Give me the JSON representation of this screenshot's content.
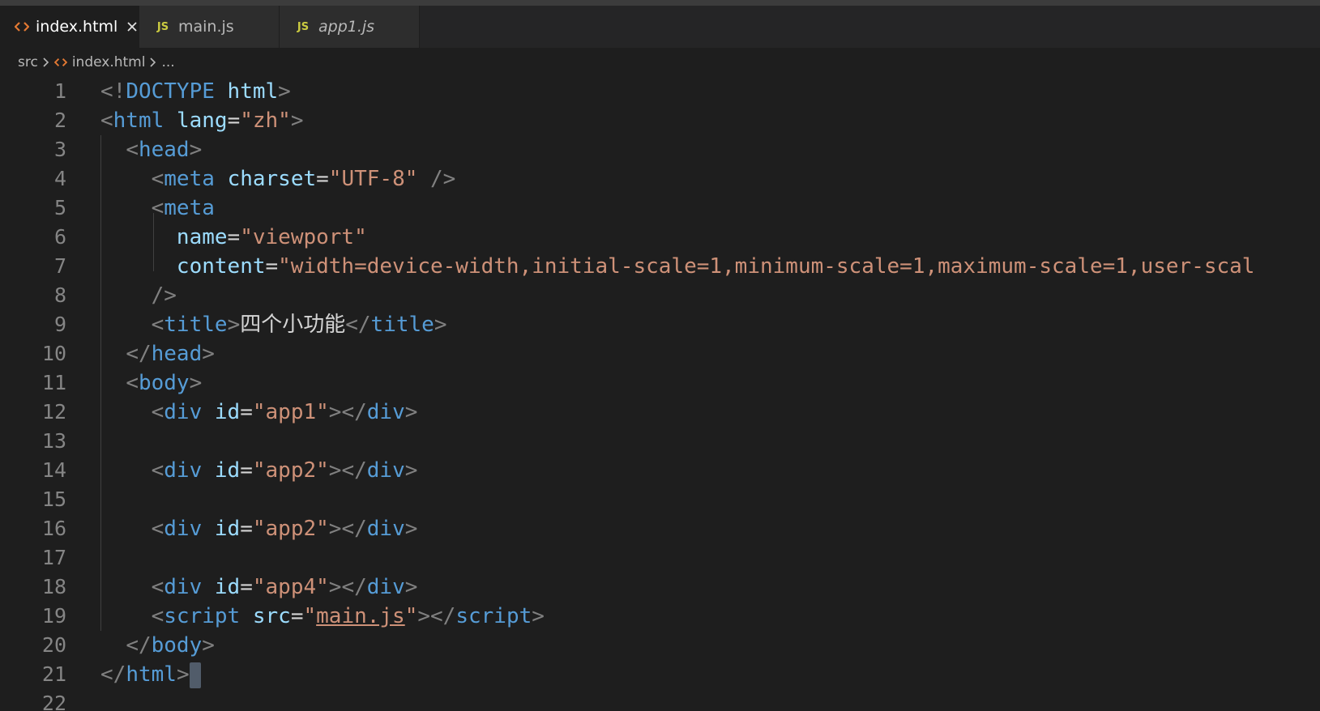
{
  "tabs": [
    {
      "label": "index.html",
      "active": true,
      "icon": "html-icon",
      "closable": true
    },
    {
      "label": "main.js",
      "active": false,
      "icon": "js-icon"
    },
    {
      "label": "app1.js",
      "active": false,
      "icon": "js-icon",
      "italic": true
    }
  ],
  "icons": {
    "js_badge": "JS"
  },
  "breadcrumb": {
    "folder": "src",
    "file": "index.html",
    "more": "..."
  },
  "colors": {
    "tag": "#569cd6",
    "attribute": "#9cdcfe",
    "string": "#ce9178",
    "punctuation": "#808080",
    "html_icon": "#e37933",
    "js_icon": "#cbcb41"
  },
  "code": {
    "line_numbers": [
      "1",
      "2",
      "3",
      "4",
      "5",
      "6",
      "7",
      "8",
      "9",
      "10",
      "11",
      "12",
      "13",
      "14",
      "15",
      "16",
      "17",
      "18",
      "19",
      "20",
      "21",
      "22"
    ],
    "lines": [
      [
        [
          "br",
          "<!"
        ],
        [
          "tag",
          "DOCTYPE"
        ],
        [
          "text",
          " "
        ],
        [
          "attr",
          "html"
        ],
        [
          "br",
          ">"
        ]
      ],
      [
        [
          "br",
          "<"
        ],
        [
          "tag",
          "html"
        ],
        [
          "text",
          " "
        ],
        [
          "attr",
          "lang"
        ],
        [
          "text",
          "="
        ],
        [
          "str",
          "\"zh\""
        ],
        [
          "br",
          ">"
        ]
      ],
      [
        [
          "text",
          "  "
        ],
        [
          "br",
          "<"
        ],
        [
          "tag",
          "head"
        ],
        [
          "br",
          ">"
        ]
      ],
      [
        [
          "text",
          "    "
        ],
        [
          "br",
          "<"
        ],
        [
          "tag",
          "meta"
        ],
        [
          "text",
          " "
        ],
        [
          "attr",
          "charset"
        ],
        [
          "text",
          "="
        ],
        [
          "str",
          "\"UTF-8\""
        ],
        [
          "text",
          " "
        ],
        [
          "br",
          "/>"
        ]
      ],
      [
        [
          "text",
          "    "
        ],
        [
          "br",
          "<"
        ],
        [
          "tag",
          "meta"
        ]
      ],
      [
        [
          "text",
          "      "
        ],
        [
          "attr",
          "name"
        ],
        [
          "text",
          "="
        ],
        [
          "str",
          "\"viewport\""
        ]
      ],
      [
        [
          "text",
          "      "
        ],
        [
          "attr",
          "content"
        ],
        [
          "text",
          "="
        ],
        [
          "str",
          "\"width=device-width,initial-scale=1,minimum-scale=1,maximum-scale=1,user-scal"
        ]
      ],
      [
        [
          "text",
          "    "
        ],
        [
          "br",
          "/>"
        ]
      ],
      [
        [
          "text",
          "    "
        ],
        [
          "br",
          "<"
        ],
        [
          "tag",
          "title"
        ],
        [
          "br",
          ">"
        ],
        [
          "text",
          "四个小功能"
        ],
        [
          "br",
          "</"
        ],
        [
          "tag",
          "title"
        ],
        [
          "br",
          ">"
        ]
      ],
      [
        [
          "text",
          "  "
        ],
        [
          "br",
          "</"
        ],
        [
          "tag",
          "head"
        ],
        [
          "br",
          ">"
        ]
      ],
      [
        [
          "text",
          "  "
        ],
        [
          "br",
          "<"
        ],
        [
          "tag",
          "body"
        ],
        [
          "br",
          ">"
        ]
      ],
      [
        [
          "text",
          "    "
        ],
        [
          "br",
          "<"
        ],
        [
          "tag",
          "div"
        ],
        [
          "text",
          " "
        ],
        [
          "attr",
          "id"
        ],
        [
          "text",
          "="
        ],
        [
          "str",
          "\"app1\""
        ],
        [
          "br",
          "></"
        ],
        [
          "tag",
          "div"
        ],
        [
          "br",
          ">"
        ]
      ],
      [],
      [
        [
          "text",
          "    "
        ],
        [
          "br",
          "<"
        ],
        [
          "tag",
          "div"
        ],
        [
          "text",
          " "
        ],
        [
          "attr",
          "id"
        ],
        [
          "text",
          "="
        ],
        [
          "str",
          "\"app2\""
        ],
        [
          "br",
          "></"
        ],
        [
          "tag",
          "div"
        ],
        [
          "br",
          ">"
        ]
      ],
      [],
      [
        [
          "text",
          "    "
        ],
        [
          "br",
          "<"
        ],
        [
          "tag",
          "div"
        ],
        [
          "text",
          " "
        ],
        [
          "attr",
          "id"
        ],
        [
          "text",
          "="
        ],
        [
          "str",
          "\"app2\""
        ],
        [
          "br",
          "></"
        ],
        [
          "tag",
          "div"
        ],
        [
          "br",
          ">"
        ]
      ],
      [],
      [
        [
          "text",
          "    "
        ],
        [
          "br",
          "<"
        ],
        [
          "tag",
          "div"
        ],
        [
          "text",
          " "
        ],
        [
          "attr",
          "id"
        ],
        [
          "text",
          "="
        ],
        [
          "str",
          "\"app4\""
        ],
        [
          "br",
          "></"
        ],
        [
          "tag",
          "div"
        ],
        [
          "br",
          ">"
        ]
      ],
      [
        [
          "text",
          "    "
        ],
        [
          "br",
          "<"
        ],
        [
          "tag",
          "script"
        ],
        [
          "text",
          " "
        ],
        [
          "attr",
          "src"
        ],
        [
          "text",
          "="
        ],
        [
          "str",
          "\""
        ],
        [
          "link",
          "main.js"
        ],
        [
          "str",
          "\""
        ],
        [
          "br",
          "></"
        ],
        [
          "tag",
          "script"
        ],
        [
          "br",
          ">"
        ]
      ],
      [
        [
          "text",
          "  "
        ],
        [
          "br",
          "</"
        ],
        [
          "tag",
          "body"
        ],
        [
          "br",
          ">"
        ]
      ],
      [
        [
          "br",
          "</"
        ],
        [
          "tag",
          "html"
        ],
        [
          "br",
          ">"
        ],
        [
          "cursor",
          ""
        ]
      ],
      []
    ]
  }
}
